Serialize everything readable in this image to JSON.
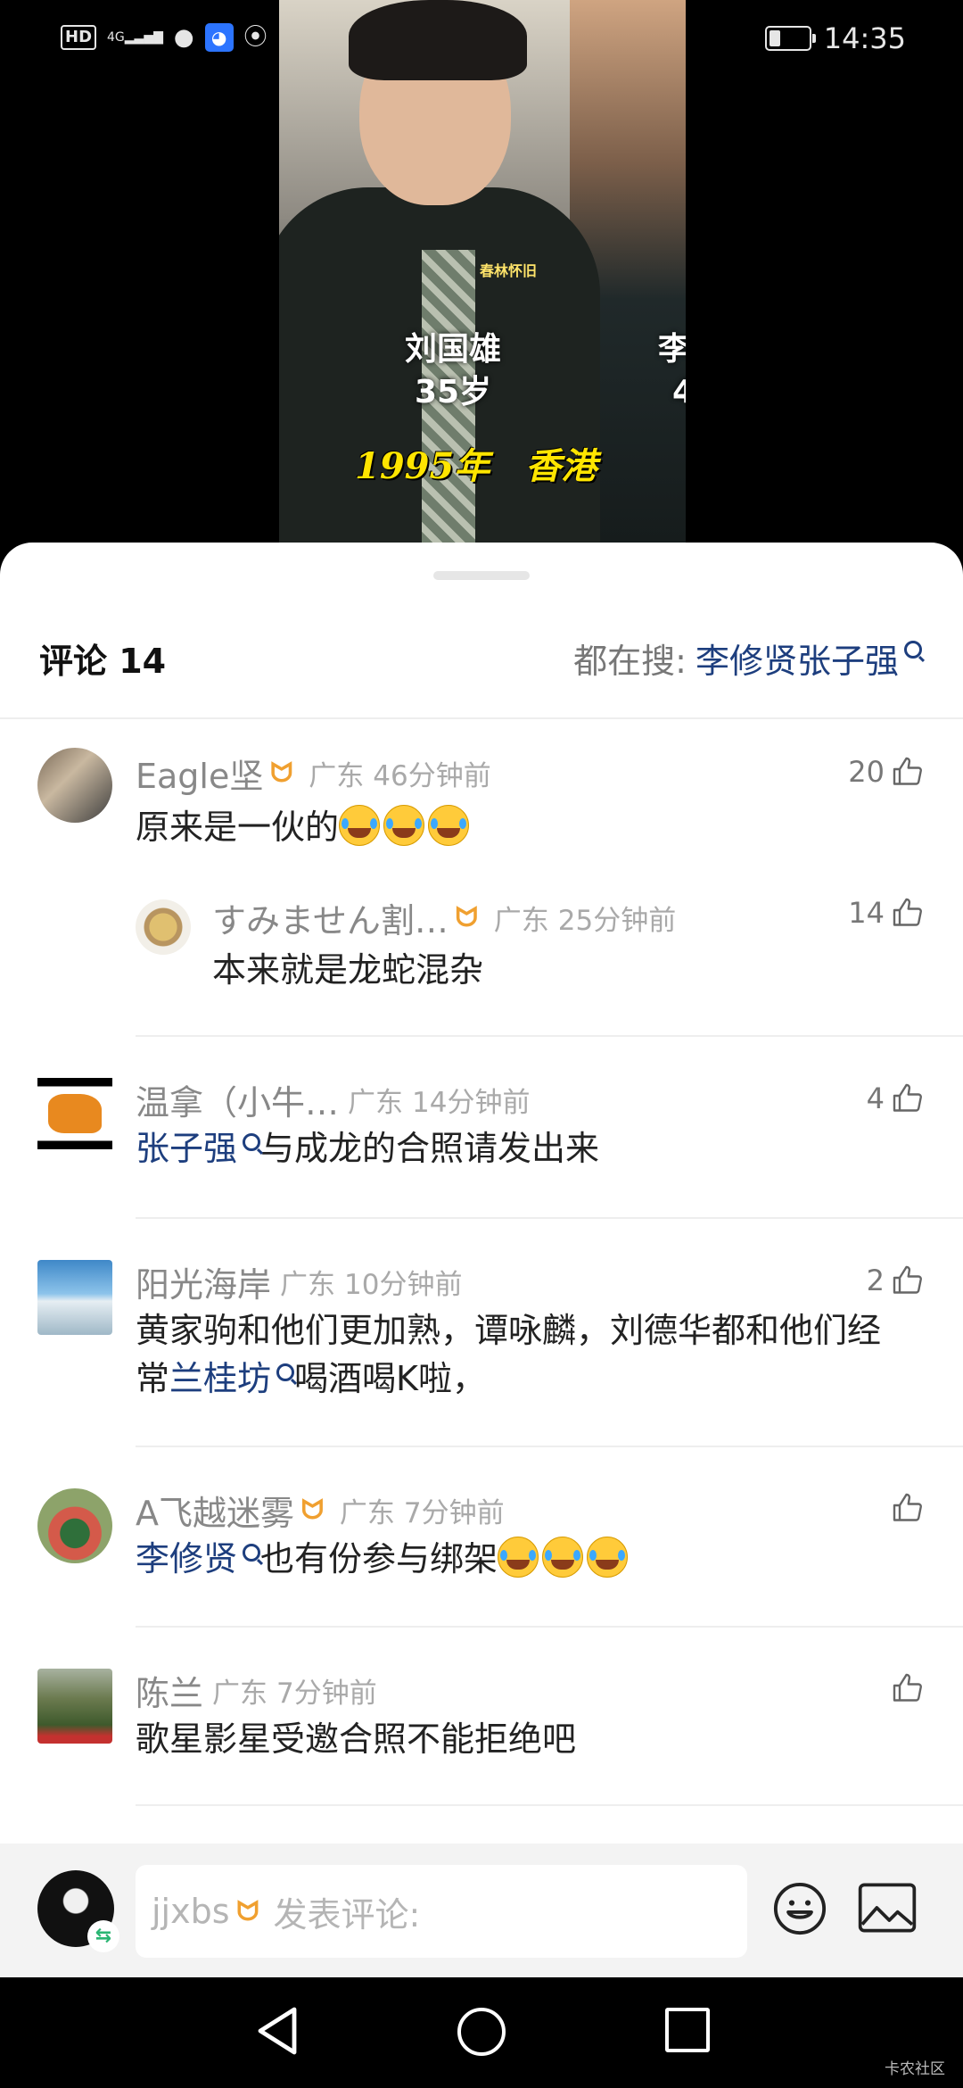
{
  "status_bar": {
    "network_hd": "HD",
    "network_4g": "4G",
    "time": "14:35",
    "icons": [
      "hd-icon",
      "signal-icon",
      "message-icon",
      "qq-icon",
      "wechat-icon",
      "battery-icon"
    ]
  },
  "video": {
    "watermark": "春林怀旧",
    "person_name": "刘国雄",
    "person_age": "35岁",
    "person2_partial_name": "李",
    "person2_partial_age": "4",
    "year_location": "1995年　香港"
  },
  "comments_header": {
    "title": "评论 14",
    "search_prefix": "都在搜:",
    "search_term": "李修贤张子强"
  },
  "comments": [
    {
      "user": "Eagle坚",
      "has_badge": true,
      "location": "广东",
      "time": "46分钟前",
      "likes": "20",
      "text": "原来是一伙的",
      "emoji_count": 3,
      "reply": {
        "user": "すみません割…",
        "has_badge": true,
        "location": "广东",
        "time": "25分钟前",
        "likes": "14",
        "text": "本来就是龙蛇混杂"
      }
    },
    {
      "user": "温拿（小牛…",
      "has_badge": false,
      "location": "广东",
      "time": "14分钟前",
      "likes": "4",
      "link": "张子强",
      "text": "与成龙的合照请发出来"
    },
    {
      "user": "阳光海岸",
      "has_badge": false,
      "location": "广东",
      "time": "10分钟前",
      "likes": "2",
      "line1": "黄家驹和他们更加熟，谭咏麟，刘德华都和他们经",
      "line2_prefix": "常",
      "link": "兰桂坊",
      "line2_suffix": "喝酒喝K啦，"
    },
    {
      "user": "A飞越迷雾",
      "has_badge": true,
      "location": "广东",
      "time": "7分钟前",
      "likes": "",
      "link": "李修贤",
      "text": "也有份参与绑架",
      "emoji_count": 3
    },
    {
      "user": "陈兰",
      "has_badge": false,
      "location": "广东",
      "time": "7分钟前",
      "likes": "",
      "text": "歌星影星受邀合照不能拒绝吧"
    }
  ],
  "badge_glyph": "ᗢ",
  "input_bar": {
    "username": "jjxbs",
    "placeholder": "发表评论:"
  },
  "nav_bar": {
    "watermark": "卡农社区"
  },
  "colors": {
    "link": "#1d3e7e",
    "badge": "#f0a030",
    "meta_gray": "#a9a9a9"
  }
}
